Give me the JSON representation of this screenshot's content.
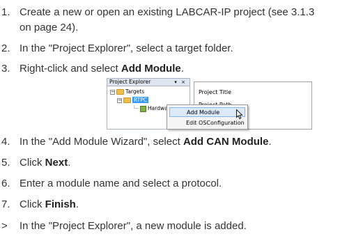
{
  "steps": [
    {
      "num": "1.",
      "text": "Create a new or open an existing LABCAR-IP project (see 3.1.3",
      "cont": "on page 24)."
    },
    {
      "num": "2.",
      "text": "In the \"Project Explorer\", select a target folder."
    },
    {
      "num": "3.",
      "pre": "Right-click and select ",
      "bold": "Add Module",
      "post": "."
    },
    {
      "num": "4.",
      "pre": "In the \"Add Module Wizard\", select ",
      "bold": "Add CAN Module",
      "post": "."
    },
    {
      "num": "5.",
      "pre": "Click ",
      "bold": "Next",
      "post": "."
    },
    {
      "num": "6.",
      "text": "Enter a module name and select a protocol."
    },
    {
      "num": "7.",
      "pre": "Click ",
      "bold": "Finish",
      "post": "."
    }
  ],
  "result": {
    "marker": ">",
    "text": "In the \"Project Explorer\", a new module is added."
  },
  "screenshot": {
    "panel_title": "Project Explorer",
    "panel_controls": "▾ ×",
    "tree": {
      "root": "Targets",
      "child": "RTPC",
      "leaf": "Hardwar"
    },
    "properties": {
      "row1": "Project Title",
      "row2": "Project Path"
    },
    "context_menu": [
      "Add Module",
      "Edit OSConfiguration"
    ]
  }
}
